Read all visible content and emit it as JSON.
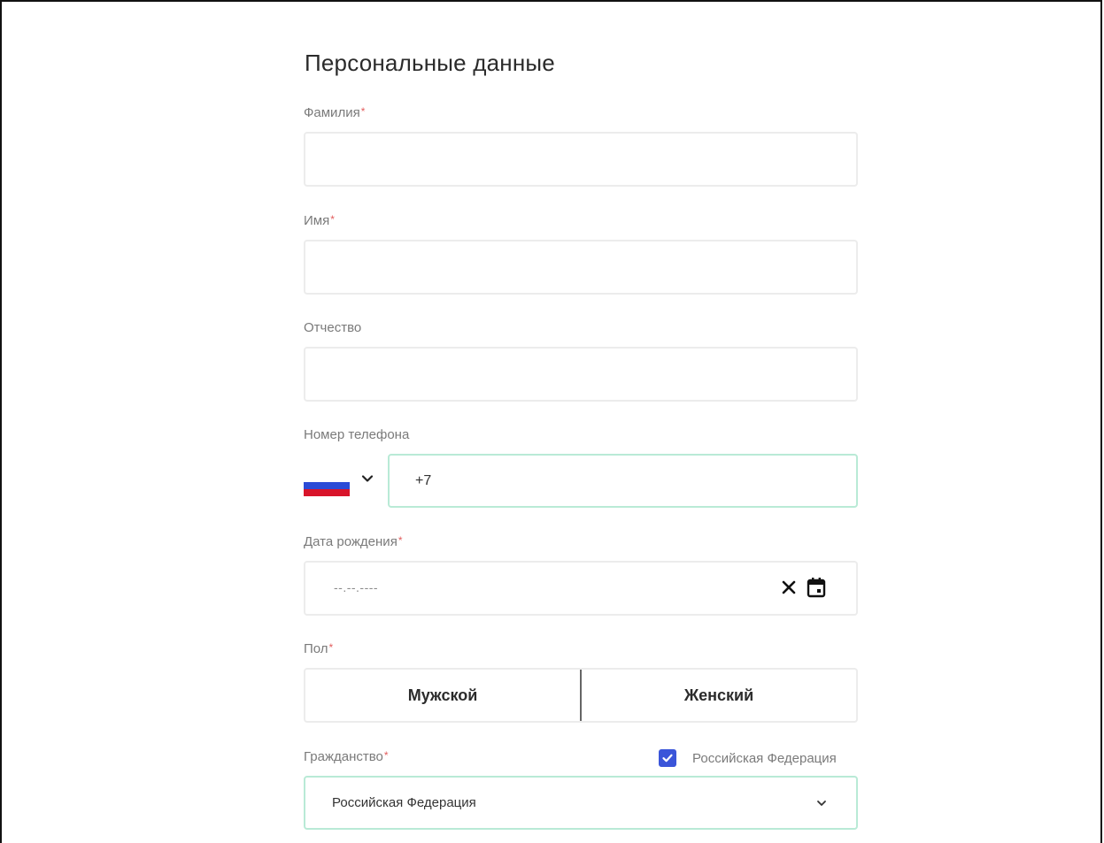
{
  "section": {
    "title": "Персональные данные",
    "required_mark": "*"
  },
  "fields": {
    "last_name": {
      "label": "Фамилия",
      "value": ""
    },
    "first_name": {
      "label": "Имя",
      "value": ""
    },
    "patronymic": {
      "label": "Отчество",
      "value": ""
    },
    "phone": {
      "label": "Номер телефона",
      "value": "+7",
      "country_flag": "russia-flag-icon"
    },
    "birth_date": {
      "label": "Дата рождения",
      "placeholder": "--.--.----"
    },
    "gender": {
      "label": "Пол",
      "options": [
        "Мужской",
        "Женский"
      ]
    },
    "citizenship": {
      "label": "Гражданство",
      "checkbox_label": "Российская Федерация",
      "checkbox_checked": true,
      "selected": "Российская Федерация"
    }
  },
  "colors": {
    "accent_border": "#b9ead6",
    "checkbox": "#3a55d9",
    "required": "#e25c5c"
  }
}
